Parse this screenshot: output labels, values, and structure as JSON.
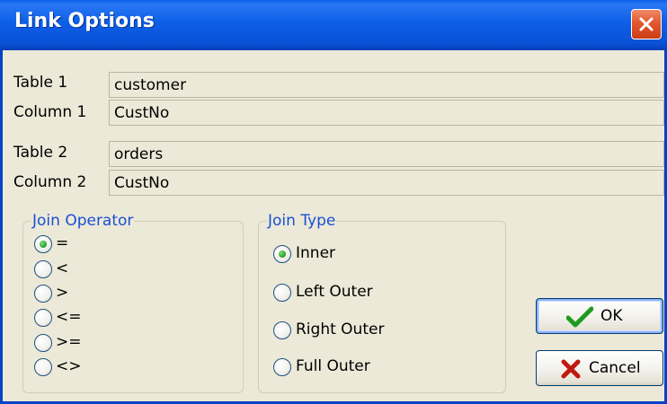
{
  "window": {
    "title": "Link Options"
  },
  "fields": {
    "table1": {
      "label": "Table 1",
      "value": "customer"
    },
    "column1": {
      "label": "Column 1",
      "value": "CustNo"
    },
    "table2": {
      "label": "Table 2",
      "value": "orders"
    },
    "column2": {
      "label": "Column 2",
      "value": "CustNo"
    }
  },
  "join_operator": {
    "legend": "Join Operator",
    "options": [
      "=",
      "<",
      ">",
      "<=",
      ">=",
      "<>"
    ],
    "selected": "="
  },
  "join_type": {
    "legend": "Join Type",
    "options": [
      "Inner",
      "Left Outer",
      "Right Outer",
      "Full Outer"
    ],
    "selected": "Inner"
  },
  "buttons": {
    "ok_label": "OK",
    "cancel_label": "Cancel"
  },
  "icons": {
    "close": "close-icon",
    "ok": "checkmark-icon",
    "cancel": "x-mark-icon"
  },
  "colors": {
    "titlebar": "#0a5ee8",
    "dialog_background": "#ece9d8",
    "legend_text": "#1a4fd6",
    "close_button": "#e2582f",
    "checkmark": "#1f9a1f",
    "x_mark": "#c01a10"
  }
}
